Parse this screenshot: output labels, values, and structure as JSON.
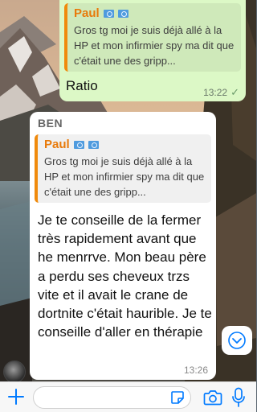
{
  "colors": {
    "accent": "#007aff",
    "outgoing_bubble": "#dcf8c6",
    "quote_bar": "#f08a0c"
  },
  "outgoing_message": {
    "quote": {
      "author": "Paul",
      "text": "Gros tg moi je suis déjà allé à la HP et mon infirmier spy ma dit que c'était une des gripp..."
    },
    "text": "Ratio",
    "time": "13:22"
  },
  "incoming_message": {
    "sender": "BEN",
    "quote": {
      "author": "Paul",
      "text": "Gros tg moi je suis déjà allé à la HP et mon infirmier spy ma dit que c'était une des gripp..."
    },
    "text": "Je te conseille de la fermer très rapidement avant que he menrrve. Mon beau père a perdu ses cheveux trzs vite et il avait le crane de dortnite c'était hauribl​e. Je te conseille d'aller en thérapie",
    "time": "13:26"
  },
  "input_bar": {
    "placeholder": "",
    "icons": [
      "plus-icon",
      "sticker-icon",
      "camera-icon",
      "microphone-icon"
    ]
  },
  "scroll_button": {
    "icon": "chevron-down-icon"
  }
}
